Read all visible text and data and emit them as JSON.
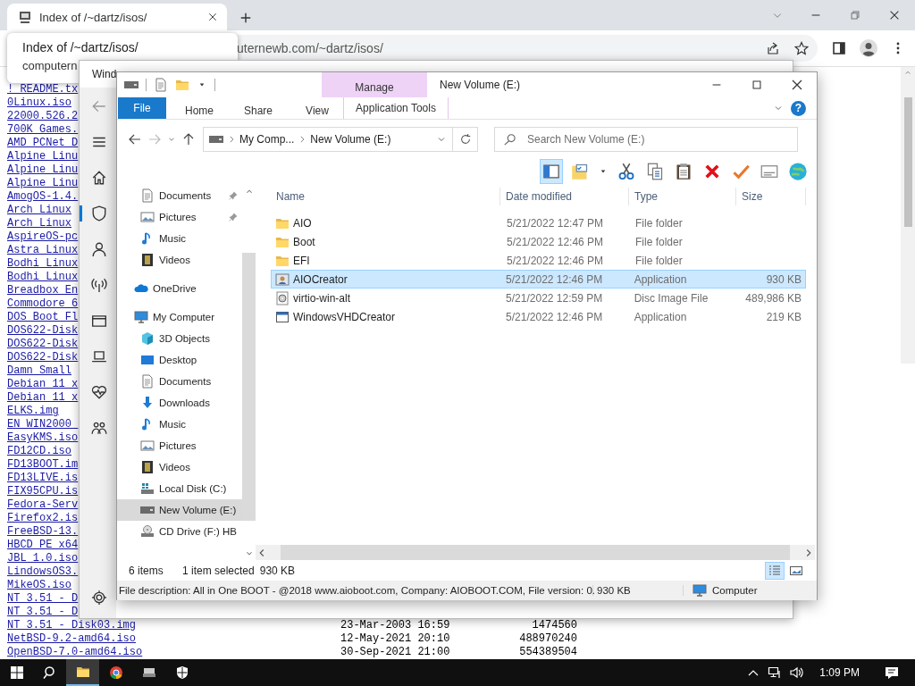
{
  "browser": {
    "tab": {
      "title": "Index of /~dartz/isos/",
      "selected": true
    },
    "tooltip": {
      "title": "Index of /~dartz/isos/",
      "url": "computern"
    },
    "address": "uternewb.com/~dartz/isos/",
    "listing": {
      "links": [
        "! README.tx",
        "0Linux.iso",
        "22000.526.2",
        "700K Games.",
        "AMD PCNet D",
        "Alpine Linu",
        "Alpine Linu",
        "Alpine Linu",
        "AmogOS-1.4.",
        "Arch Linux",
        "Arch Linux",
        "AspireOS-pc",
        "Astra Linux",
        "Bodhi Linux",
        "Bodhi Linux",
        "Breadbox En",
        "Commodore_6",
        "DOS Boot Fl",
        "DOS622-Disk",
        "DOS622-Disk",
        "DOS622-Disk",
        "Damn Small",
        "Debian 11 x",
        "Debian 11 x",
        "ELKS.img",
        "EN_WIN2000_",
        "EasyKMS.iso",
        "FD12CD.iso",
        "FD13BOOT.im",
        "FD13LIVE.is",
        "FIX95CPU.is",
        "Fedora-Serv",
        "Firefox2.is",
        "FreeBSD-13.",
        "HBCD_PE_x64",
        "JBL_1.0.iso",
        "LindowsOS3.",
        "MikeOS.iso",
        "NT 3.51 - D",
        "NT 3.51 - D"
      ],
      "rows": [
        {
          "name": "NT 3.51 - Disk03.img",
          "date": "23-Mar-2003 16:59",
          "size": "1474560"
        },
        {
          "name": "NetBSD-9.2-amd64.iso",
          "date": "12-May-2021 20:10",
          "size": "488970240"
        },
        {
          "name": "OpenBSD-7.0-amd64.iso",
          "date": "30-Sep-2021 21:00",
          "size": "554389504"
        }
      ]
    }
  },
  "security_window": {
    "title": "Wind",
    "nav": [
      {
        "kind": "back",
        "selected": false
      },
      {
        "kind": "menu",
        "selected": false
      },
      {
        "kind": "home",
        "selected": false
      },
      {
        "kind": "shield",
        "selected": true
      },
      {
        "kind": "person",
        "selected": false
      },
      {
        "kind": "antenna",
        "selected": false
      },
      {
        "kind": "appwin",
        "selected": false
      },
      {
        "kind": "laptop",
        "selected": false
      },
      {
        "kind": "heart",
        "selected": false
      },
      {
        "kind": "people",
        "selected": false
      },
      {
        "kind": "gear",
        "selected": false
      }
    ]
  },
  "explorer": {
    "title": "New Volume (E:)",
    "contextual_tab": "Manage",
    "ribbon_tabs": [
      {
        "label": "File",
        "kind": "file",
        "selected": false
      },
      {
        "label": "Home",
        "kind": "tab",
        "selected": false
      },
      {
        "label": "Share",
        "kind": "tab",
        "selected": false
      },
      {
        "label": "View",
        "kind": "tab",
        "selected": false
      },
      {
        "label": "Application Tools",
        "kind": "contextual",
        "selected": false
      }
    ],
    "help": "?",
    "breadcrumb": [
      "My Comp...",
      "New Volume (E:)"
    ],
    "search": {
      "placeholder": "Search New Volume (E:)"
    },
    "toolbar": [
      {
        "kind": "preview",
        "selected": true
      },
      {
        "kind": "props",
        "selected": false
      },
      {
        "kind": "caret",
        "selected": false
      },
      {
        "kind": "scissors",
        "selected": false
      },
      {
        "kind": "copy",
        "selected": false
      },
      {
        "kind": "paste",
        "selected": false
      },
      {
        "kind": "delete",
        "selected": false
      },
      {
        "kind": "check",
        "selected": false
      },
      {
        "kind": "card",
        "selected": false
      },
      {
        "kind": "globe",
        "selected": false
      }
    ],
    "nav_pane": {
      "quick_access": [
        {
          "label": "Documents",
          "kind": "document",
          "pinned": true,
          "selected": false
        },
        {
          "label": "Pictures",
          "kind": "picture",
          "pinned": true,
          "selected": false
        },
        {
          "label": "Music",
          "kind": "music",
          "pinned": false,
          "selected": false
        },
        {
          "label": "Videos",
          "kind": "film",
          "pinned": false,
          "selected": false
        }
      ],
      "items": [
        {
          "label": "OneDrive",
          "kind": "cloud",
          "selected": false
        },
        {
          "label": "My Computer",
          "kind": "monitor",
          "selected": false,
          "children": [
            {
              "label": "3D Objects",
              "kind": "cube",
              "selected": false
            },
            {
              "label": "Desktop",
              "kind": "desktop",
              "selected": false
            },
            {
              "label": "Documents",
              "kind": "document",
              "selected": false
            },
            {
              "label": "Downloads",
              "kind": "download",
              "selected": false
            },
            {
              "label": "Music",
              "kind": "music",
              "selected": false
            },
            {
              "label": "Pictures",
              "kind": "picture",
              "selected": false
            },
            {
              "label": "Videos",
              "kind": "film",
              "selected": false
            },
            {
              "label": "Local Disk (C:)",
              "kind": "diskc",
              "selected": false
            },
            {
              "label": "New Volume (E:)",
              "kind": "drive",
              "selected": true
            },
            {
              "label": "CD Drive (F:) HB",
              "kind": "cd",
              "selected": false
            }
          ]
        }
      ]
    },
    "columns": [
      "Name",
      "Date modified",
      "Type",
      "Size"
    ],
    "files": [
      {
        "name": "AIO",
        "date": "5/21/2022 12:47 PM",
        "type": "File folder",
        "kind": "folder",
        "selected": false
      },
      {
        "name": "Boot",
        "date": "5/21/2022 12:46 PM",
        "type": "File folder",
        "kind": "folder",
        "selected": false
      },
      {
        "name": "EFI",
        "date": "5/21/2022 12:46 PM",
        "type": "File folder",
        "kind": "folder",
        "selected": false
      },
      {
        "name": "AIOCreator",
        "date": "5/21/2022 12:46 PM",
        "type": "Application",
        "size": "930 KB",
        "kind": "app",
        "selected": true
      },
      {
        "name": "virtio-win-alt",
        "date": "5/21/2022 12:59 PM",
        "type": "Disc Image File",
        "size": "489,986 KB",
        "kind": "disc",
        "selected": false
      },
      {
        "name": "WindowsVHDCreator",
        "date": "5/21/2022 12:46 PM",
        "type": "Application",
        "size": "219 KB",
        "kind": "window",
        "selected": false
      }
    ],
    "status": {
      "count": "6 items",
      "selection": "1 item selected",
      "size": "930 KB"
    },
    "view_modes": [
      {
        "kind": "details",
        "selected": true
      },
      {
        "kind": "thumbs",
        "selected": false
      }
    ],
    "details_bar": {
      "description": "File description: All in One BOOT - @2018 www.aioboot.com, Company: AIOBOOT.COM, File version: 0.",
      "size": "930 KB",
      "location": "Computer"
    }
  },
  "taskbar": {
    "apps": [
      {
        "kind": "start",
        "selected": false
      },
      {
        "kind": "search",
        "selected": false
      },
      {
        "kind": "folder",
        "selected": true
      },
      {
        "kind": "browser",
        "selected": false
      },
      {
        "kind": "device",
        "selected": false
      },
      {
        "kind": "wshield",
        "selected": false
      }
    ],
    "tray": [
      {
        "kind": "chevup"
      },
      {
        "kind": "network"
      },
      {
        "kind": "speaker"
      }
    ],
    "time": "1:09 PM"
  }
}
